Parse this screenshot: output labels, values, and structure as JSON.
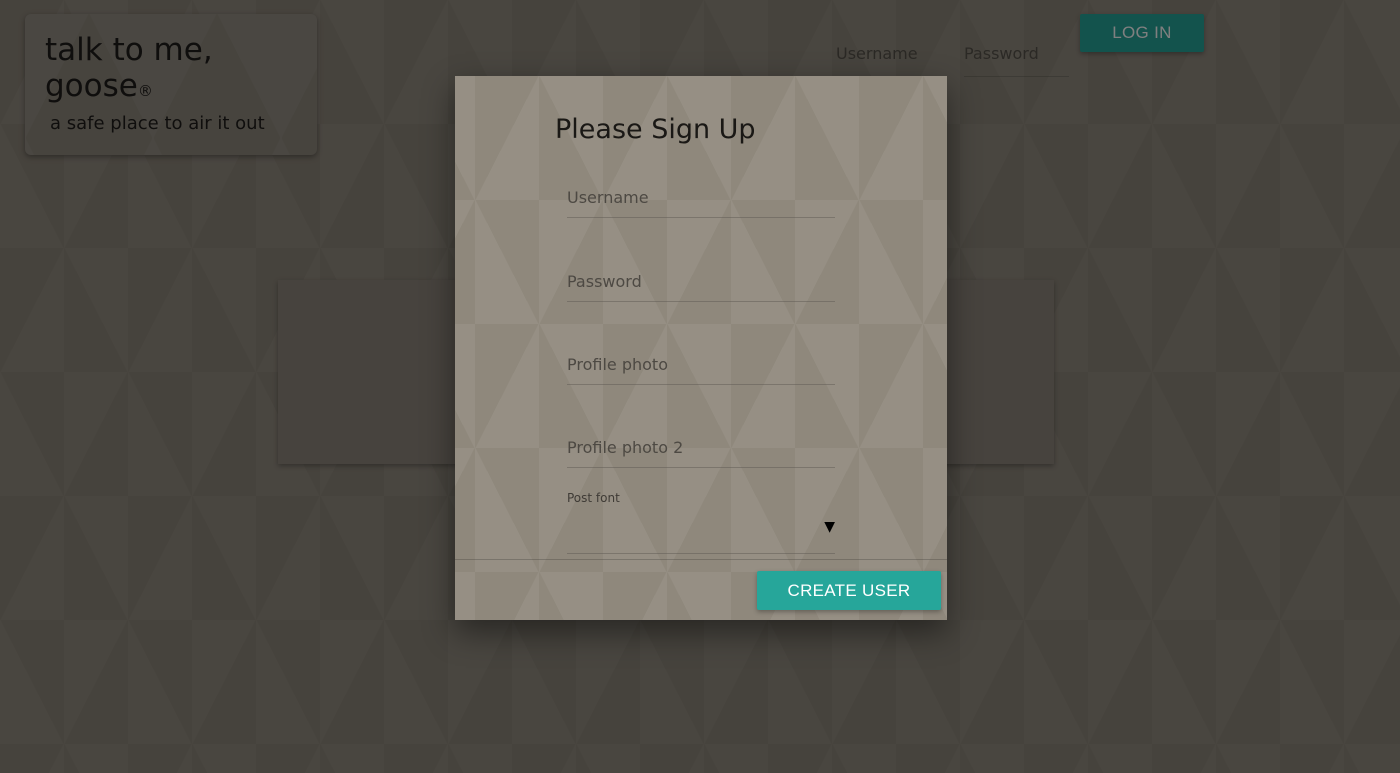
{
  "header": {
    "brand_title": "talk to me, goose",
    "brand_mark": "®",
    "tagline": "a safe place to air it out",
    "username_placeholder": "Username",
    "password_placeholder": "Password",
    "login_label": "LOG IN"
  },
  "modal": {
    "title": "Please Sign Up",
    "fields": {
      "username": "Username",
      "password": "Password",
      "profile_photo": "Profile photo",
      "profile_photo_2": "Profile photo 2"
    },
    "post_font_label": "Post font",
    "post_font_value": "",
    "select_arrow": "▼",
    "create_label": "CREATE USER"
  },
  "colors": {
    "accent": "#26a69a",
    "background": "#8d867a"
  }
}
